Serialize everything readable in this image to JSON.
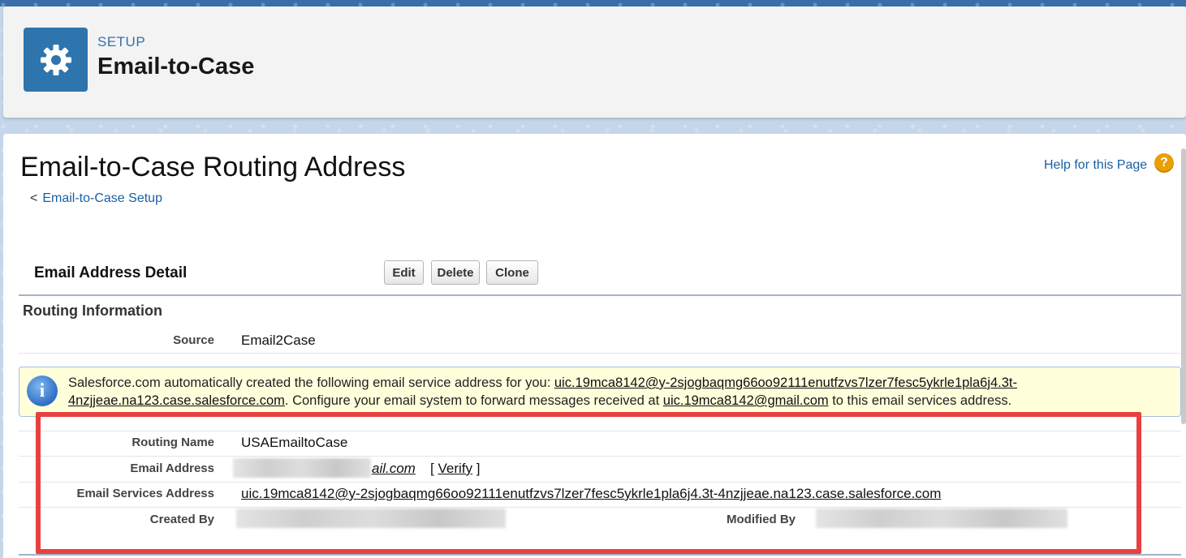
{
  "header": {
    "overline": "SETUP",
    "title": "Email-to-Case"
  },
  "page": {
    "title": "Email-to-Case Routing Address",
    "breadcrumb_prefix": "<",
    "breadcrumb_link": "Email-to-Case Setup",
    "help_link": "Help for this Page",
    "help_icon_glyph": "?"
  },
  "detail": {
    "title": "Email Address Detail",
    "buttons": {
      "edit": "Edit",
      "delete": "Delete",
      "clone": "Clone"
    },
    "section_heading": "Routing Information",
    "source_label": "Source",
    "source_value": "Email2Case",
    "info": {
      "icon_glyph": "i",
      "text_before": "Salesforce.com automatically created the following email service address for you: ",
      "service_address_link": "uic.19mca8142@y-2sjogbaqmg66oo92111enutfzvs7lzer7fesc5ykrle1pla6j4.3t-4nzjjeae.na123.case.salesforce.com",
      "text_middle": ". Configure your email system to forward messages received at ",
      "forward_address_link": "uic.19mca8142@gmail.com",
      "text_after": " to this email services address."
    },
    "routing_name_label": "Routing Name",
    "routing_name_value": "USAEmailtoCase",
    "email_address_label": "Email Address",
    "email_address_visible_suffix": "ail.com",
    "verify_open": "[",
    "verify_link": "Verify",
    "verify_close": "]",
    "email_services_label": "Email Services Address",
    "email_services_value": "uic.19mca8142@y-2sjogbaqmg66oo92111enutfzvs7lzer7fesc5ykrle1pla6j4.3t-4nzjjeae.na123.case.salesforce.com",
    "created_by_label": "Created By",
    "modified_by_label": "Modified By"
  },
  "colors": {
    "brand_blue": "#2e74ad",
    "link_blue": "#1a5fa3",
    "highlight_red": "#e84040",
    "info_bg": "#ffffdc"
  },
  "icons": {
    "header": "gear-icon",
    "help": "help-icon",
    "info": "info-icon"
  }
}
